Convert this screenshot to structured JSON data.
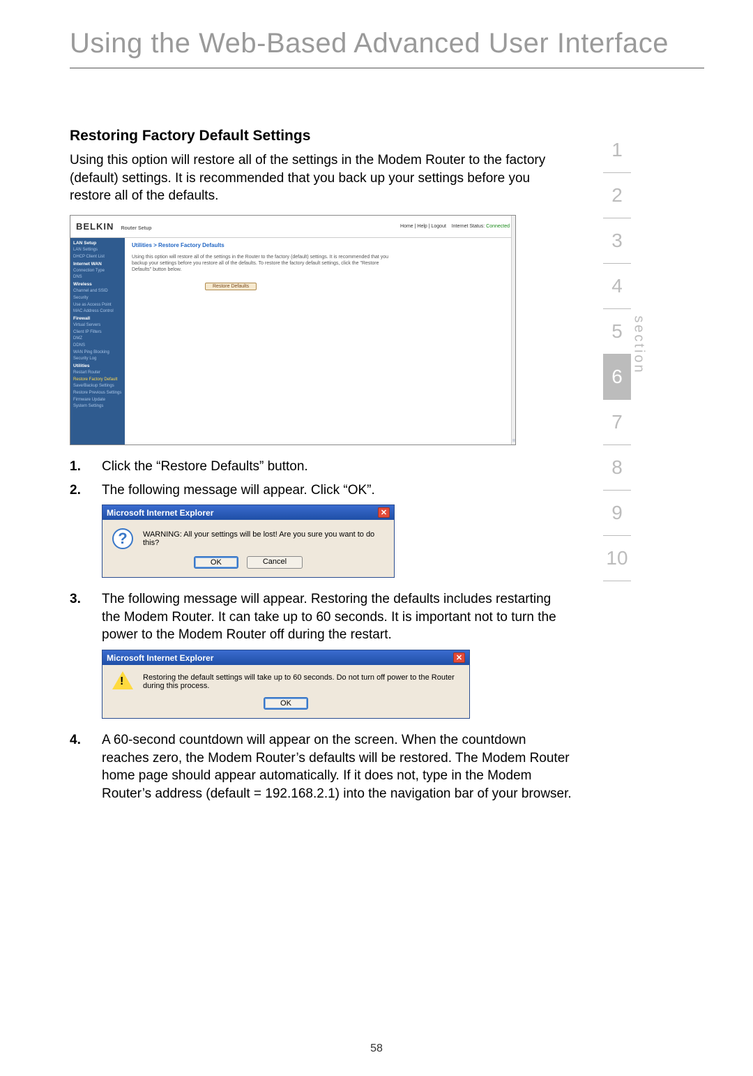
{
  "page_title_text": "Using the Web-Based Advanced User Interface",
  "section_heading": "Restoring Factory Default Settings",
  "intro_text": "Using this option will restore all of the settings in the Modem Router to the factory (default) settings. It is recommended that you back up your settings before you restore all of the defaults.",
  "router_screenshot": {
    "brand": "BELKIN",
    "subbrand": "Router Setup",
    "header_links_left": "Home | Help | Logout",
    "header_links_status_label": "Internet Status:",
    "header_links_status_value": "Connected",
    "breadcrumb": "Utilities > Restore Factory Defaults",
    "main_paragraph": "Using this option will restore all of the settings in the Router to the factory (default) settings. It is recommended that you backup your settings before you restore all of the defaults. To restore the factory default settings, click the \"Restore Defaults\" button below.",
    "restore_button": "Restore Defaults",
    "sidebar": [
      {
        "text": "LAN Setup",
        "cls": "sb-head"
      },
      {
        "text": "LAN Settings",
        "cls": "sb-item"
      },
      {
        "text": "DHCP Client List",
        "cls": "sb-item"
      },
      {
        "text": "Internet WAN",
        "cls": "sb-head"
      },
      {
        "text": "Connection Type",
        "cls": "sb-item"
      },
      {
        "text": "DNS",
        "cls": "sb-item"
      },
      {
        "text": "Wireless",
        "cls": "sb-head"
      },
      {
        "text": "Channel and SSID",
        "cls": "sb-item"
      },
      {
        "text": "Security",
        "cls": "sb-item"
      },
      {
        "text": "Use as Access Point",
        "cls": "sb-item"
      },
      {
        "text": "MAC Address Control",
        "cls": "sb-item"
      },
      {
        "text": "Firewall",
        "cls": "sb-head"
      },
      {
        "text": "Virtual Servers",
        "cls": "sb-item"
      },
      {
        "text": "Client IP Filters",
        "cls": "sb-item"
      },
      {
        "text": "DMZ",
        "cls": "sb-item"
      },
      {
        "text": "DDNS",
        "cls": "sb-item"
      },
      {
        "text": "WAN Ping Blocking",
        "cls": "sb-item"
      },
      {
        "text": "Security Log",
        "cls": "sb-item"
      },
      {
        "text": "Utilities",
        "cls": "sb-head"
      },
      {
        "text": "Restart Router",
        "cls": "sb-item"
      },
      {
        "text": "Restore Factory Default",
        "cls": "sb-active"
      },
      {
        "text": "Save/Backup Settings",
        "cls": "sb-item"
      },
      {
        "text": "Restore Previous Settings",
        "cls": "sb-item"
      },
      {
        "text": "Firmware Update",
        "cls": "sb-item"
      },
      {
        "text": "System Settings",
        "cls": "sb-item"
      }
    ]
  },
  "steps": {
    "s1_num": "1.",
    "s1_text": "Click the “Restore Defaults” button.",
    "s2_num": "2.",
    "s2_text": "The following message will appear. Click “OK”.",
    "s3_num": "3.",
    "s3_text": "The following message will appear. Restoring the defaults includes restarting the Modem Router. It can take up to 60 seconds. It is important not to turn the power to the Modem Router off during the restart.",
    "s4_num": "4.",
    "s4_text": "A 60-second countdown will appear on the screen. When the countdown reaches zero, the Modem Router’s defaults will be restored. The Modem Router home page should appear automatically. If it does not, type in the Modem Router’s address (default = 192.168.2.1) into the navigation bar of your browser."
  },
  "dialog1": {
    "title": "Microsoft Internet Explorer",
    "message": "WARNING: All your settings will be lost! Are you sure you want to do this?",
    "ok": "OK",
    "cancel": "Cancel"
  },
  "dialog2": {
    "title": "Microsoft Internet Explorer",
    "message": "Restoring the default settings will take up to 60 seconds. Do not turn off power to the Router during this process.",
    "ok": "OK"
  },
  "side_nav": [
    "1",
    "2",
    "3",
    "4",
    "5",
    "6",
    "7",
    "8",
    "9",
    "10"
  ],
  "side_nav_active_index": 5,
  "section_label": "section",
  "page_number": "58"
}
